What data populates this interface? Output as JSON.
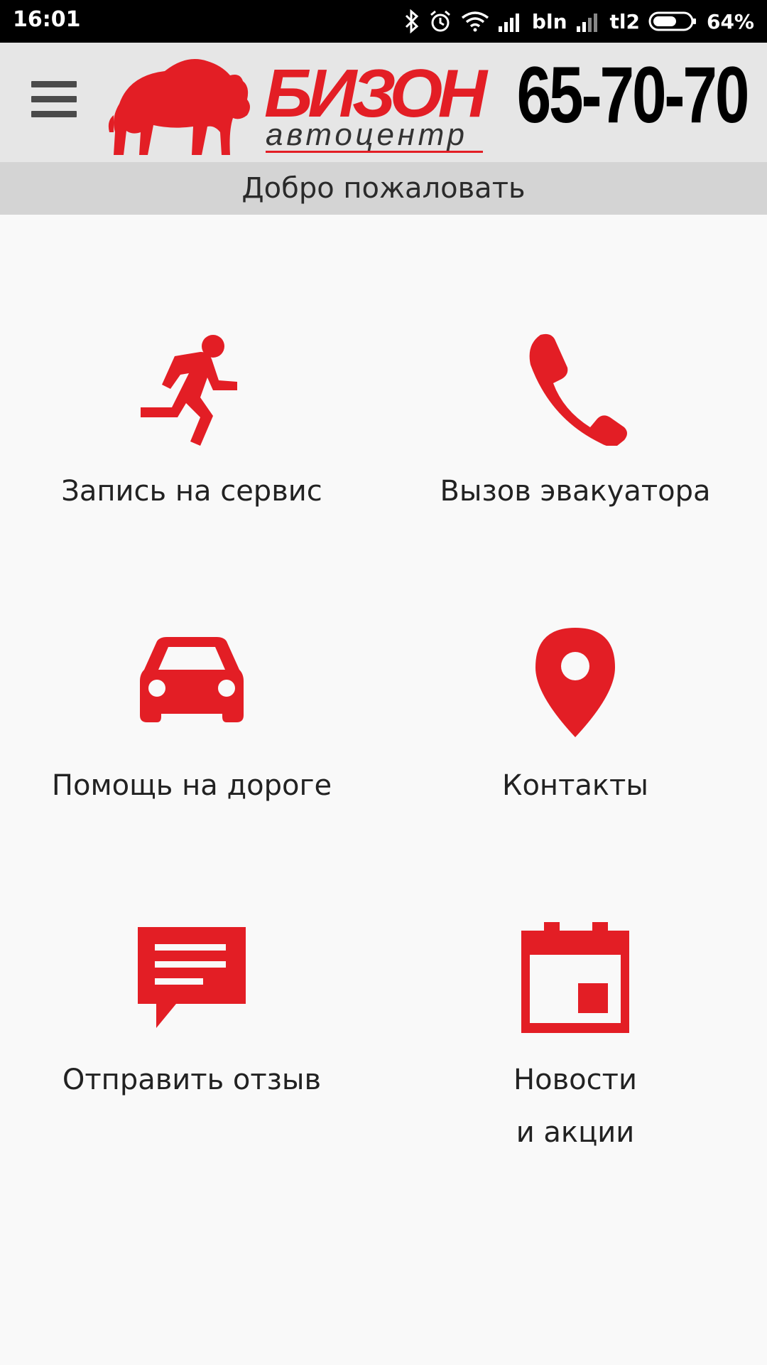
{
  "status_bar": {
    "time": "16:01",
    "carrier1": "bln",
    "carrier2": "tl2",
    "battery": "64%",
    "battery_level": 0.64
  },
  "header": {
    "brand_name": "БИЗОН",
    "brand_sub": "автоцентр",
    "phone": "65-70-70",
    "accent_color": "#e31e25"
  },
  "welcome": "Добро пожаловать",
  "tiles": [
    {
      "label": "Запись на сервис",
      "icon": "running-person-icon"
    },
    {
      "label": "Вызов эвакуатора",
      "icon": "phone-icon"
    },
    {
      "label": "Помощь на дороге",
      "icon": "car-icon"
    },
    {
      "label": "Контакты",
      "icon": "map-pin-icon"
    },
    {
      "label": "Отправить отзыв",
      "icon": "message-icon"
    },
    {
      "label": "Новости\nи акции",
      "icon": "calendar-icon"
    }
  ]
}
